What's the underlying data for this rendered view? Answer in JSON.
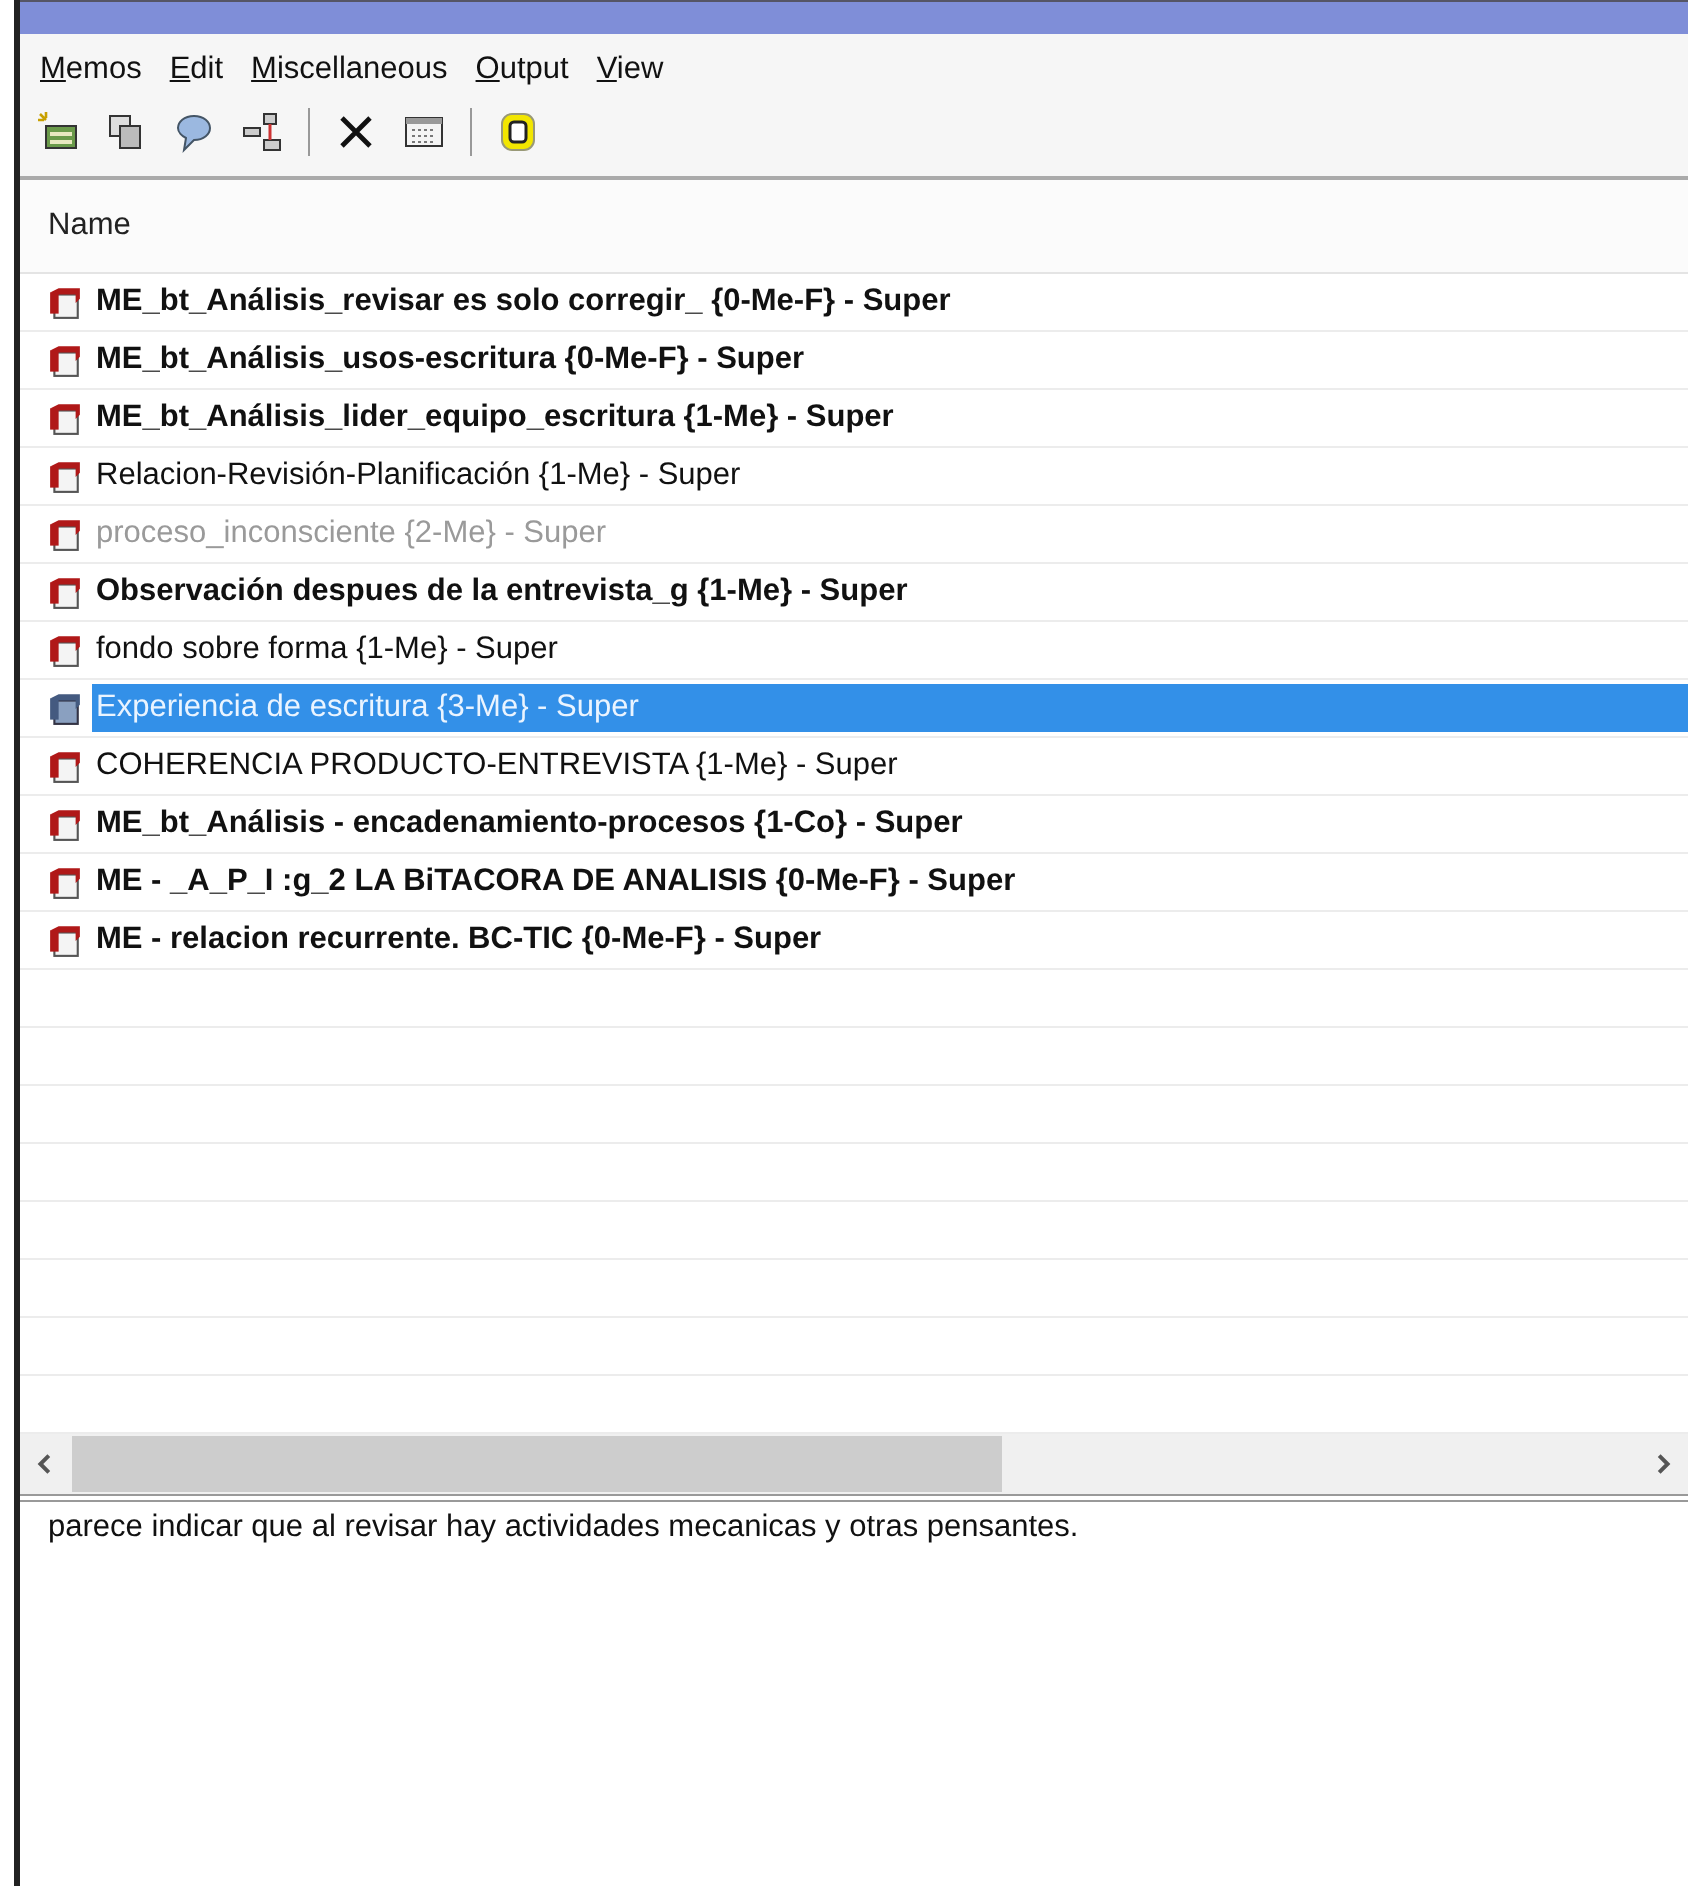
{
  "menu": [
    {
      "label": "Memos"
    },
    {
      "label": "Edit"
    },
    {
      "label": "Miscellaneous"
    },
    {
      "label": "Output"
    },
    {
      "label": "View"
    }
  ],
  "list": {
    "column": "Name",
    "rows": [
      {
        "label": "ME_bt_Análisis_revisar es solo corregir_ {0-Me-F} - Super",
        "bold": true,
        "disabled": false,
        "selected": false
      },
      {
        "label": "ME_bt_Análisis_usos-escritura {0-Me-F} - Super",
        "bold": true,
        "disabled": false,
        "selected": false
      },
      {
        "label": "ME_bt_Análisis_lider_equipo_escritura {1-Me} - Super",
        "bold": true,
        "disabled": false,
        "selected": false
      },
      {
        "label": "Relacion-Revisión-Planificación {1-Me} - Super",
        "bold": false,
        "disabled": false,
        "selected": false
      },
      {
        "label": "proceso_inconsciente {2-Me} - Super",
        "bold": false,
        "disabled": true,
        "selected": false
      },
      {
        "label": "Observación despues de la entrevista_g {1-Me} - Super",
        "bold": true,
        "disabled": false,
        "selected": false
      },
      {
        "label": "fondo sobre forma {1-Me} - Super",
        "bold": false,
        "disabled": false,
        "selected": false
      },
      {
        "label": "Experiencia de escritura {3-Me} - Super",
        "bold": false,
        "disabled": false,
        "selected": true
      },
      {
        "label": "COHERENCIA PRODUCTO-ENTREVISTA {1-Me} - Super",
        "bold": false,
        "disabled": false,
        "selected": false
      },
      {
        "label": "ME_bt_Análisis - encadenamiento-procesos {1-Co} - Super",
        "bold": true,
        "disabled": false,
        "selected": false
      },
      {
        "label": "ME - _A_P_I :g_2 LA BiTACORA DE ANALISIS {0-Me-F} - Super",
        "bold": true,
        "disabled": false,
        "selected": false
      },
      {
        "label": "ME - relacion recurrente. BC-TIC {0-Me-F} - Super",
        "bold": true,
        "disabled": false,
        "selected": false
      }
    ]
  },
  "preview": {
    "text": "parece indicar que al revisar hay actividades mecanicas y otras pensantes."
  }
}
